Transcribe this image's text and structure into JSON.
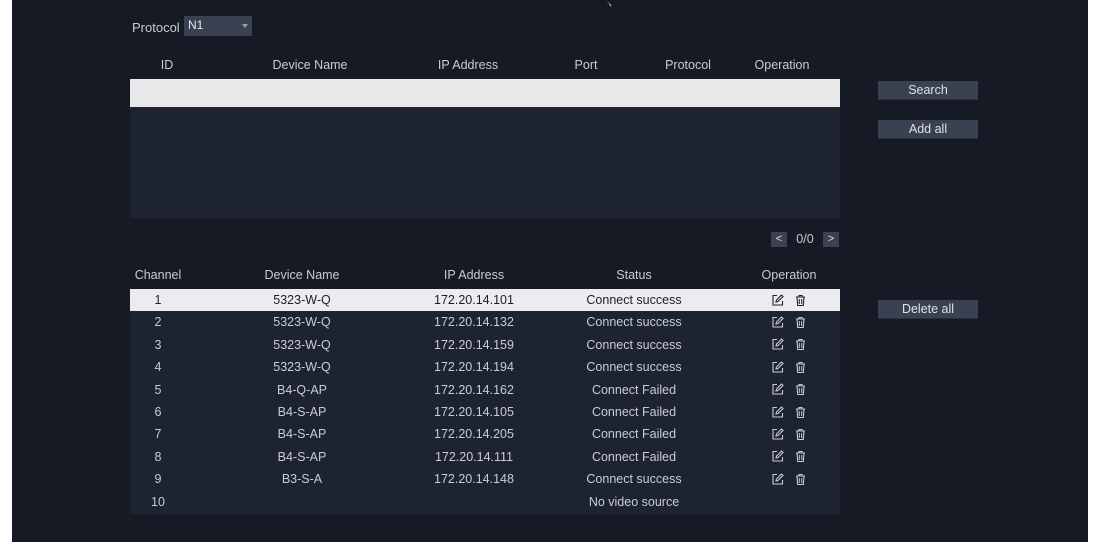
{
  "protocol_filter": {
    "label": "Protocol",
    "value": "N1"
  },
  "search_table": {
    "headers": [
      "ID",
      "Device Name",
      "IP Address",
      "Port",
      "Protocol",
      "Operation"
    ]
  },
  "buttons": {
    "search": "Search",
    "add_all": "Add all",
    "delete_all": "Delete all"
  },
  "pager": {
    "prev": "<",
    "page_text": "0/0",
    "next": ">"
  },
  "channel_table": {
    "headers": [
      "Channel",
      "Device Name",
      "IP Address",
      "Status",
      "Operation"
    ],
    "rows": [
      {
        "channel": "1",
        "name": "5323-W-Q",
        "ip": "172.20.14.101",
        "status": "Connect success"
      },
      {
        "channel": "2",
        "name": "5323-W-Q",
        "ip": "172.20.14.132",
        "status": "Connect success"
      },
      {
        "channel": "3",
        "name": "5323-W-Q",
        "ip": "172.20.14.159",
        "status": "Connect success"
      },
      {
        "channel": "4",
        "name": "5323-W-Q",
        "ip": "172.20.14.194",
        "status": "Connect success"
      },
      {
        "channel": "5",
        "name": "B4-Q-AP",
        "ip": "172.20.14.162",
        "status": "Connect Failed"
      },
      {
        "channel": "6",
        "name": "B4-S-AP",
        "ip": "172.20.14.105",
        "status": "Connect Failed"
      },
      {
        "channel": "7",
        "name": "B4-S-AP",
        "ip": "172.20.14.205",
        "status": "Connect Failed"
      },
      {
        "channel": "8",
        "name": "B4-S-AP",
        "ip": "172.20.14.111",
        "status": "Connect Failed"
      },
      {
        "channel": "9",
        "name": "B3-S-A",
        "ip": "172.20.14.148",
        "status": "Connect success"
      },
      {
        "channel": "10",
        "name": "",
        "ip": "",
        "status": "No video source"
      }
    ]
  },
  "colors": {
    "background": "#161a24",
    "panel": "#1d2331",
    "button": "#3a4150",
    "selected_row": "#ececef"
  }
}
